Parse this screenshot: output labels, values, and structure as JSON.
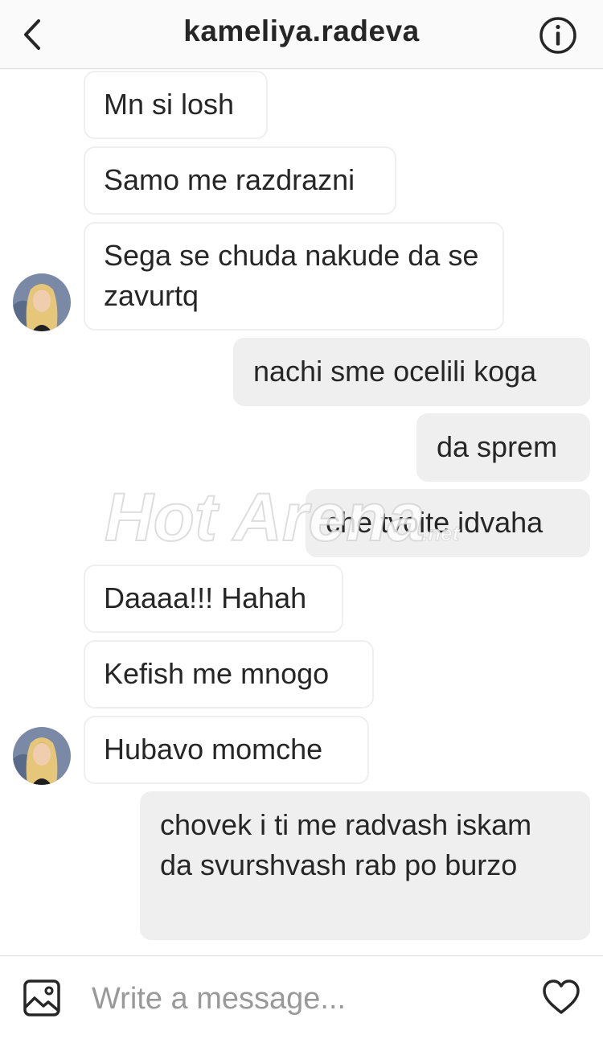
{
  "header": {
    "title": "kameliya.radeva",
    "back_icon": "chevron-left-icon",
    "info_icon": "info-icon"
  },
  "messages": [
    {
      "from": "them",
      "text": "Mn si losh"
    },
    {
      "from": "them",
      "text": "Samo me razdrazni"
    },
    {
      "from": "them",
      "text": "Sega se chuda nakude da se zavurtq"
    },
    {
      "from": "me",
      "text": "nachi sme ocelili koga"
    },
    {
      "from": "me",
      "text": "da sprem"
    },
    {
      "from": "me",
      "text": "che tvoite idvaha"
    },
    {
      "from": "them",
      "text": "Daaaa!!! Hahah"
    },
    {
      "from": "them",
      "text": "Kefish me mnogo"
    },
    {
      "from": "them",
      "text": "Hubavo momche"
    },
    {
      "from": "me",
      "text": "chovek i ti me radvash iskam da svurshvash rab po burzo"
    }
  ],
  "watermark": "Hot Arena.net",
  "composer": {
    "placeholder": "Write a message...",
    "gallery_icon": "gallery-icon",
    "heart_icon": "heart-icon"
  },
  "colors": {
    "incoming_bubble": "#ffffff",
    "outgoing_bubble": "#efefef",
    "border": "#dbdbdb",
    "text": "#262626",
    "placeholder": "#999999"
  }
}
